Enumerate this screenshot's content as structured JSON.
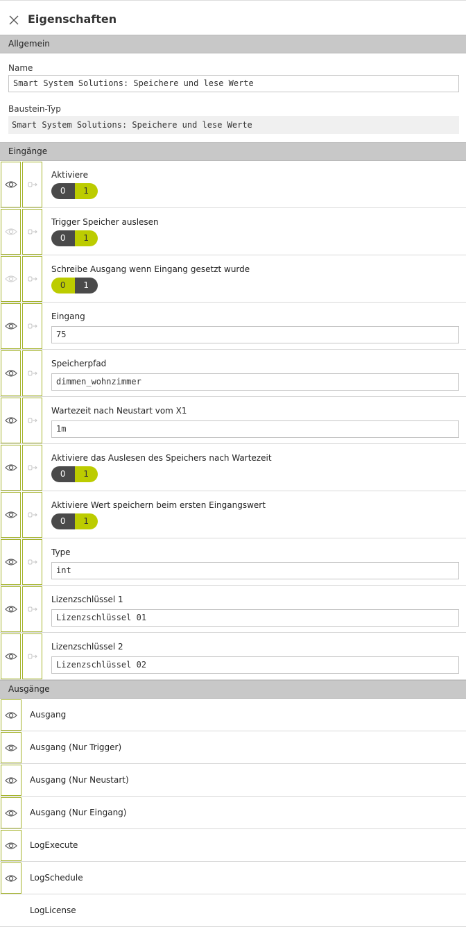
{
  "header": {
    "title": "Eigenschaften"
  },
  "general": {
    "section_title": "Allgemein",
    "name_label": "Name",
    "name_value": "Smart System Solutions: Speichere und lese Werte",
    "type_label": "Baustein-Typ",
    "type_value": "Smart System Solutions: Speichere und lese Werte"
  },
  "inputs": {
    "section_title": "Eingänge",
    "items": [
      {
        "label": "Aktiviere",
        "kind": "toggle",
        "value": "1",
        "off_label": "0",
        "on_label": "1",
        "eye_visible": true
      },
      {
        "label": "Trigger Speicher auslesen",
        "kind": "toggle",
        "value": "1",
        "off_label": "0",
        "on_label": "1",
        "eye_visible": false
      },
      {
        "label": "Schreibe Ausgang wenn Eingang gesetzt wurde",
        "kind": "toggle",
        "value": "0",
        "off_label": "0",
        "on_label": "1",
        "eye_visible": false
      },
      {
        "label": "Eingang",
        "kind": "text",
        "value": "75",
        "eye_visible": true
      },
      {
        "label": "Speicherpfad",
        "kind": "text",
        "value": "dimmen_wohnzimmer",
        "eye_visible": true
      },
      {
        "label": "Wartezeit nach Neustart vom X1",
        "kind": "text",
        "value": "1m",
        "eye_visible": true
      },
      {
        "label": "Aktiviere das Auslesen des Speichers nach Wartezeit",
        "kind": "toggle",
        "value": "1",
        "off_label": "0",
        "on_label": "1",
        "eye_visible": true
      },
      {
        "label": "Aktiviere Wert speichern beim ersten Eingangswert",
        "kind": "toggle",
        "value": "1",
        "off_label": "0",
        "on_label": "1",
        "eye_visible": true
      },
      {
        "label": "Type",
        "kind": "text",
        "value": "int",
        "eye_visible": true
      },
      {
        "label": "Lizenzschlüssel 1",
        "kind": "text",
        "value": "Lizenzschlüssel 01",
        "eye_visible": true
      },
      {
        "label": "Lizenzschlüssel 2",
        "kind": "text",
        "value": "Lizenzschlüssel 02",
        "eye_visible": true
      }
    ]
  },
  "outputs": {
    "section_title": "Ausgänge",
    "items": [
      {
        "label": "Ausgang",
        "eye": true
      },
      {
        "label": "Ausgang (Nur Trigger)",
        "eye": true
      },
      {
        "label": "Ausgang (Nur Neustart)",
        "eye": true
      },
      {
        "label": "Ausgang (Nur Eingang)",
        "eye": true
      },
      {
        "label": "LogExecute",
        "eye": true
      },
      {
        "label": "LogSchedule",
        "eye": true
      },
      {
        "label": "LogLicense",
        "eye": false
      }
    ]
  },
  "colors": {
    "accent": "#bccc00",
    "border_accent": "#a4b32a",
    "toggle_dark": "#4a4a4a",
    "section_bg": "#c8c8c8"
  },
  "icons": {
    "close": "close-icon",
    "eye": "eye-icon",
    "connect": "connect-icon"
  }
}
